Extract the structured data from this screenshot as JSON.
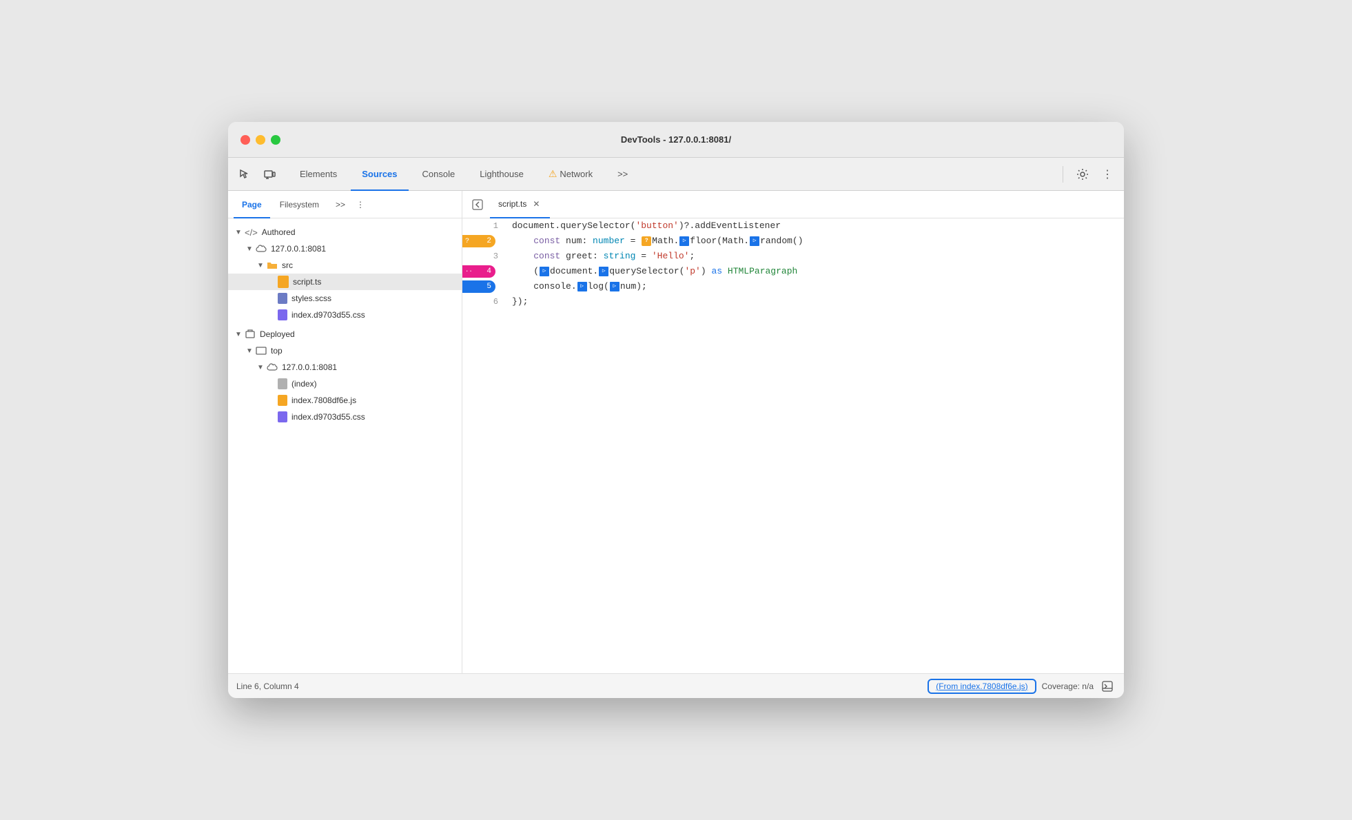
{
  "window": {
    "title": "DevTools - 127.0.0.1:8081/"
  },
  "toolbar": {
    "tabs": [
      {
        "id": "elements",
        "label": "Elements",
        "active": false,
        "warning": false
      },
      {
        "id": "sources",
        "label": "Sources",
        "active": true,
        "warning": false
      },
      {
        "id": "console",
        "label": "Console",
        "active": false,
        "warning": false
      },
      {
        "id": "lighthouse",
        "label": "Lighthouse",
        "active": false,
        "warning": false
      },
      {
        "id": "network",
        "label": "Network",
        "active": false,
        "warning": true
      }
    ],
    "more_tabs_label": ">>",
    "settings_icon": "⚙",
    "more_icon": "⋮"
  },
  "sidebar": {
    "tabs": [
      {
        "id": "page",
        "label": "Page",
        "active": true
      },
      {
        "id": "filesystem",
        "label": "Filesystem",
        "active": false
      }
    ],
    "more_label": ">>",
    "more_options": "⋮",
    "tree": [
      {
        "id": "authored",
        "indent": 0,
        "arrow": "▼",
        "icon": "tag",
        "label": "</> Authored"
      },
      {
        "id": "authored-host",
        "indent": 1,
        "arrow": "▼",
        "icon": "cloud",
        "label": "127.0.0.1:8081"
      },
      {
        "id": "src-folder",
        "indent": 2,
        "arrow": "▼",
        "icon": "folder",
        "label": "src"
      },
      {
        "id": "script-ts",
        "indent": 3,
        "arrow": "",
        "icon": "ts",
        "label": "script.ts",
        "selected": true
      },
      {
        "id": "styles-scss",
        "indent": 3,
        "arrow": "",
        "icon": "scss",
        "label": "styles.scss"
      },
      {
        "id": "index-css",
        "indent": 3,
        "arrow": "",
        "icon": "css",
        "label": "index.d9703d55.css"
      },
      {
        "id": "deployed",
        "indent": 0,
        "arrow": "▼",
        "icon": "box",
        "label": "Deployed"
      },
      {
        "id": "top-folder",
        "indent": 1,
        "arrow": "▼",
        "icon": "rect",
        "label": "top"
      },
      {
        "id": "deployed-host",
        "indent": 2,
        "arrow": "▼",
        "icon": "cloud",
        "label": "127.0.0.1:8081"
      },
      {
        "id": "index-html",
        "indent": 3,
        "arrow": "",
        "icon": "html",
        "label": "(index)"
      },
      {
        "id": "index-js",
        "indent": 3,
        "arrow": "",
        "icon": "js",
        "label": "index.7808df6e.js"
      },
      {
        "id": "index-css2",
        "indent": 3,
        "arrow": "",
        "icon": "css",
        "label": "index.d9703d55.css"
      }
    ]
  },
  "editor": {
    "tab_back_icon": "◀",
    "open_file": "script.ts",
    "close_icon": "✕",
    "lines": [
      {
        "num": 1,
        "badge": null,
        "content": "document.querySelector('button')?.addEventListener"
      },
      {
        "num": 2,
        "badge": "orange",
        "badge_label": "2",
        "content": "    const num: number = 🟠Math.▷floor(Math.▷random()"
      },
      {
        "num": 3,
        "badge": null,
        "content": "    const greet: string = 'Hello';"
      },
      {
        "num": 4,
        "badge": "magenta",
        "badge_label": "4",
        "content": "    (▷document.▷querySelector('p') as HTMLParagraph"
      },
      {
        "num": 5,
        "badge": "blue",
        "badge_label": "5",
        "content": "    console.▷log(▷num);"
      },
      {
        "num": 6,
        "badge": null,
        "content": "});"
      }
    ]
  },
  "statusbar": {
    "position": "Line 6, Column 4",
    "source_prefix": "(From ",
    "source_file": "index.7808df6e.js",
    "source_suffix": ")",
    "coverage": "Coverage: n/a"
  }
}
